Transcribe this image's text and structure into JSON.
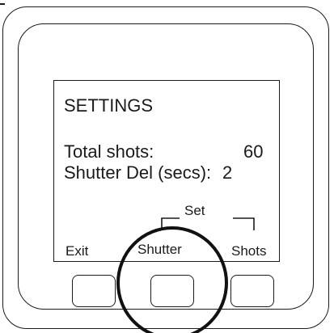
{
  "screen": {
    "title": "SETTINGS",
    "rows": [
      {
        "label": "Total shots:",
        "value": "60"
      },
      {
        "label": "Shutter Del (secs):",
        "value": "2"
      }
    ]
  },
  "softkeys": {
    "group_label": "Set",
    "left": "Exit",
    "middle": "Shutter",
    "right": "Shots"
  },
  "colors": {
    "line": "#1a1a1a",
    "background": "#ffffff"
  }
}
